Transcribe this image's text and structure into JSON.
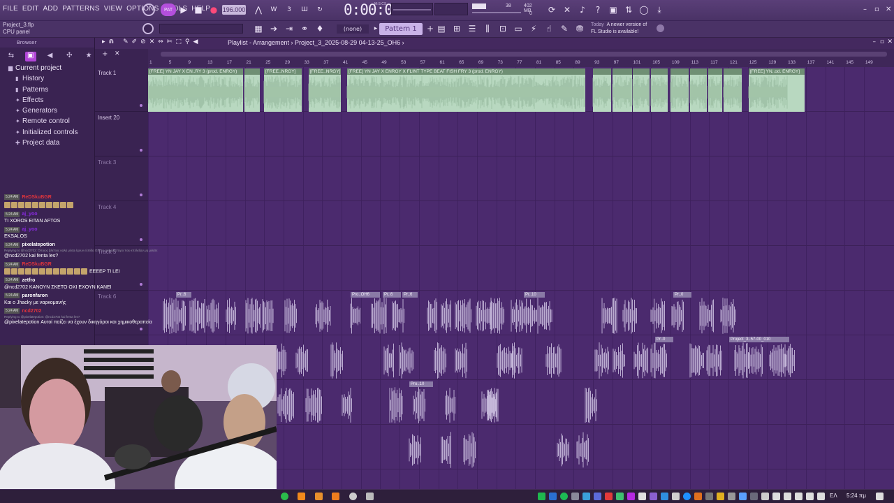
{
  "menu": {
    "items": [
      "FILE",
      "EDIT",
      "ADD",
      "PATTERNS",
      "VIEW",
      "OPTIONS",
      "TOOLS",
      "HELP"
    ]
  },
  "transport": {
    "tempo": "196.000",
    "time": "0:00:00",
    "time_unit": "M:S:CS",
    "cpu_value": "38",
    "ram_value": "402 MB",
    "voices": "0"
  },
  "toolbar2": {
    "project_file": "Project_3.flp",
    "hint": "CPU panel",
    "snap": "(none)",
    "pattern": "Pattern 1",
    "news_today": "Today",
    "news_text_1": "A newer version of",
    "news_text_2": "FL Studio is available!"
  },
  "browser": {
    "title": "Browser",
    "root": "Current project",
    "items": [
      "History",
      "Patterns",
      "Effects",
      "Generators",
      "Remote control",
      "Initialized controls",
      "Project data"
    ]
  },
  "playlist": {
    "title": "Playlist - Arrangement",
    "breadcrumb": "Project_3_2025-08-29 04-13-25_OH6",
    "bars": [
      "1",
      "5",
      "9",
      "13",
      "17",
      "21",
      "25",
      "29",
      "33",
      "37",
      "41",
      "45",
      "49",
      "53",
      "57",
      "61",
      "65",
      "69",
      "73",
      "77",
      "81",
      "85",
      "89",
      "93",
      "97",
      "101",
      "105",
      "109",
      "113",
      "117",
      "121",
      "125",
      "129",
      "133",
      "137",
      "141",
      "145",
      "149"
    ],
    "tracks": [
      {
        "name": "Track 1"
      },
      {
        "name": "Insert 20"
      },
      {
        "name": "Track 3"
      },
      {
        "name": "Track 4"
      },
      {
        "name": "Track 5"
      },
      {
        "name": "Track 6"
      }
    ],
    "clip_labels": {
      "c1": "[FREE] YN JAY X EN..RY 3 (prod. ENRGY)",
      "c2": "[FREE..NRGY]",
      "c3": "[FREE..NRGY]",
      "c4": "[FREE] YN JAY X ENRGY X FLINT TYPE BEAT FISH FRY 3 (prod. ENRGY)",
      "c5": "[FREE] YN..od. ENRGY]",
      "s1": "Pro..OH6",
      "s2": "Pr..6",
      "s3": "Pr..6",
      "s4": "Pr..10",
      "s5": "Pr..0",
      "s6": "Pr..0",
      "s7": "Project_3..57-00_010",
      "s8": "Pro..10",
      "s9": "Pr..6"
    }
  },
  "chat": {
    "messages": [
      {
        "time": "5:24 AM",
        "user": "ReDSkuBGR",
        "text": ""
      },
      {
        "time": "5:24 AM",
        "user": "aj_yoo",
        "text": "TI XOROS EITAN AFTOS"
      },
      {
        "time": "5:24 AM",
        "user": "aj_yoo",
        "text": "EKSALOS"
      },
      {
        "time": "5:24 AM",
        "user": "pixelatepotion",
        "reply": "Replying to @ncd2702: Όποιος βλέπεις καλά μέσα έχουν ελπίδα ΟΧΙ το ασφαλέστερο που επέλεξαν μη μιλάτε",
        "text": "@ncd2702 kai fenta les?"
      },
      {
        "time": "5:24 AM",
        "user": "ReDSkuBGR",
        "text": "EEEEP TI LEI"
      },
      {
        "time": "5:24 AM",
        "user": "zetfro",
        "text": "@ncd2702 ΚΑΝΟΥΝ ΣΚΕΤΟ ΟΧΙ ΕΧΟΥΝ ΚΑΝΕΙ"
      },
      {
        "time": "5:24 AM",
        "user": "paronfaron",
        "text": "Και ο Jhacky με ναρκομανής"
      },
      {
        "time": "5:24 AM",
        "user": "ncd2702",
        "reply": "Replying to @pixelatepotion: @ncd2702 kai fenta les?",
        "text": "@pixelatepotion Αυτοί παίζει να έχουν δικηγόροι και χημικοθεραπεία"
      }
    ]
  },
  "taskbar": {
    "lang": "ΕΛ",
    "clock": "5:24 πμ"
  },
  "colors": {
    "accent": "#b246d8",
    "audio_clip": "#b8d8c0",
    "lane_bg": "#4b2a6e"
  }
}
